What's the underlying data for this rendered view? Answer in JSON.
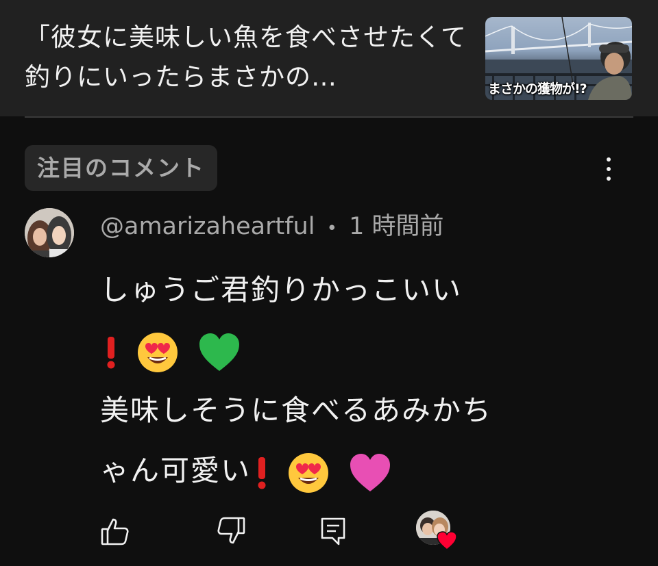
{
  "video": {
    "title": "「彼女に美味しい魚を食べさせたくて釣りにいったらまさかの…",
    "thumbnail_caption": "まさかの獲物が!?"
  },
  "pinned_section": {
    "label": "注目のコメント"
  },
  "comment": {
    "author": "@amarizaheartful",
    "separator": "•",
    "time": "1 時間前",
    "lines": [
      "しゅうご君釣りかっこいい",
      "",
      "美味しそうに食べるあみかち",
      "ゃん可愛い"
    ]
  },
  "icons": {
    "more": "more-vert-icon",
    "like": "thumbs-up-icon",
    "dislike": "thumbs-down-icon",
    "reply": "reply-icon",
    "creator_heart": "heart-icon"
  },
  "colors": {
    "background": "#0f0f0f",
    "header": "#212121",
    "secondary_text": "#aaaaaa",
    "heart": "#ff0033",
    "green_heart": "#2db84d",
    "pink_heart": "#e84fb4",
    "exclamation": "#e02020"
  }
}
